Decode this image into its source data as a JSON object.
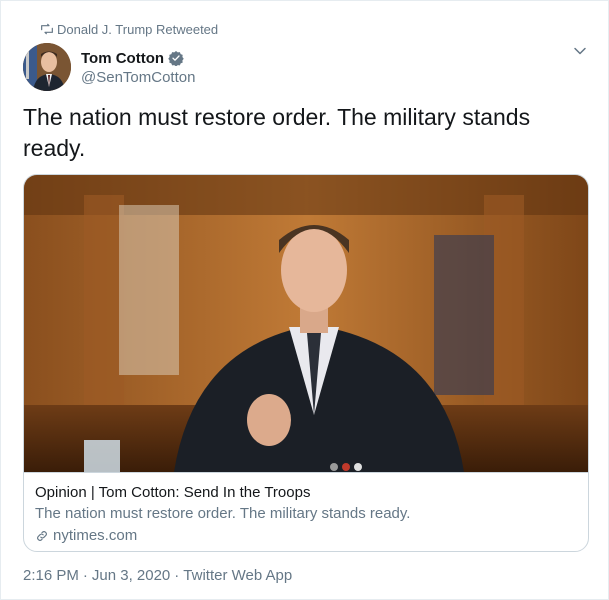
{
  "retweet": {
    "label": "Donald J. Trump Retweeted",
    "icon": "retweet-icon"
  },
  "author": {
    "display_name": "Tom Cotton",
    "handle": "@SenTomCotton",
    "verified_icon": "verified-badge-icon",
    "verified_color": "#657786"
  },
  "menu": {
    "icon": "chevron-down-icon"
  },
  "tweet": {
    "text": "The nation must restore order. The military stands ready."
  },
  "card": {
    "title": "Opinion | Tom Cotton: Send In the Troops",
    "description": "The nation must restore order. The military stands ready.",
    "domain": "nytimes.com",
    "link_icon": "link-icon"
  },
  "meta": {
    "time": "2:16 PM",
    "separator": "·",
    "date": "Jun 3, 2020",
    "source": "Twitter Web App"
  },
  "colors": {
    "text": "#14171a",
    "secondary": "#657786",
    "border": "#ccd6dd"
  }
}
